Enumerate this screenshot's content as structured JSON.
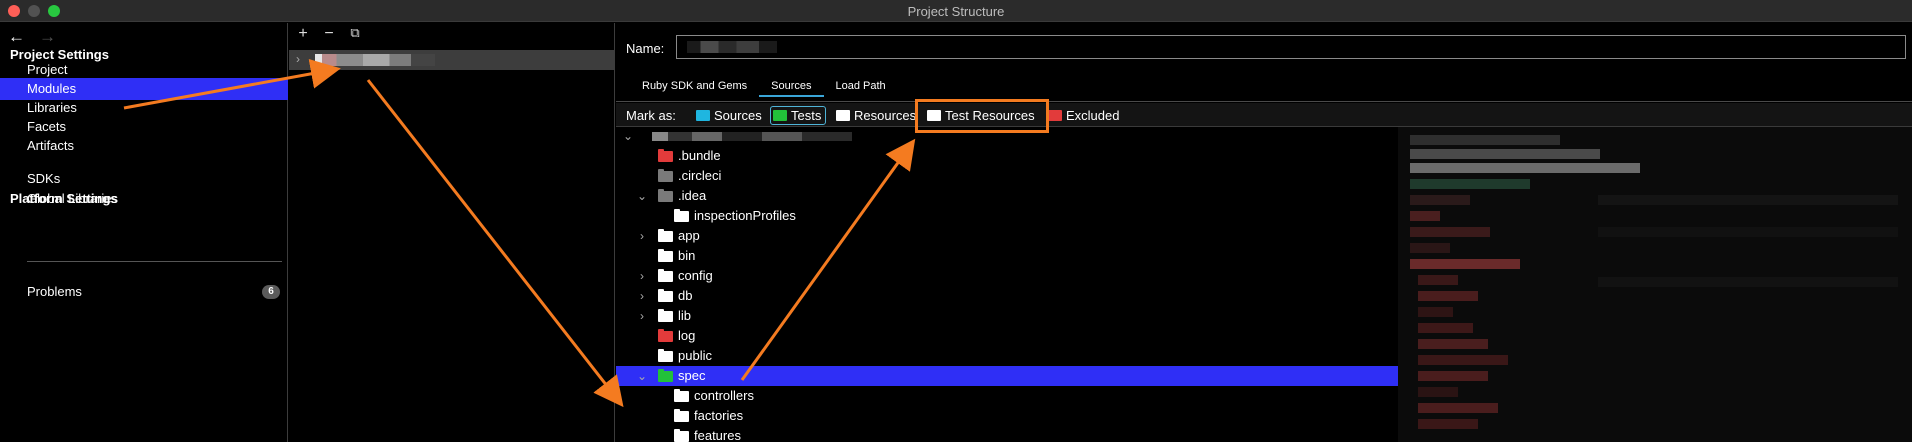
{
  "window": {
    "title": "Project Structure"
  },
  "left_nav": {
    "back_glyph": "←",
    "forward_glyph": "→",
    "project_settings_heading": "Project Settings",
    "project_settings_items": [
      "Project",
      "Modules",
      "Libraries",
      "Facets",
      "Artifacts"
    ],
    "selected_item": "Modules",
    "platform_settings_heading": "Platform Settings",
    "platform_settings_items": [
      "SDKs",
      "Global Libraries"
    ],
    "problems_label": "Problems",
    "problems_count": "6"
  },
  "modules_toolbar": {
    "add": "+",
    "remove": "−",
    "copy": "⧉"
  },
  "module_detail": {
    "name_label": "Name:",
    "tabs": [
      "Ruby SDK and Gems",
      "Sources",
      "Load Path"
    ],
    "active_tab": "Sources",
    "mark_as_label": "Mark as:",
    "mark_as_options": [
      {
        "label": "Sources",
        "folder_color": "#1fb6e0"
      },
      {
        "label": "Tests",
        "folder_color": "#22c13a"
      },
      {
        "label": "Resources",
        "folder_color": "#ffffff"
      },
      {
        "label": "Test Resources",
        "folder_color": "#ffffff"
      },
      {
        "label": "Excluded",
        "folder_color": "#e23b3b"
      }
    ],
    "highlighted_option": "Test Resources"
  },
  "tree": {
    "rows": [
      {
        "label": ".bundle",
        "color": "red",
        "indent": 1,
        "chevron": ""
      },
      {
        "label": ".circleci",
        "color": "grey",
        "indent": 1,
        "chevron": ""
      },
      {
        "label": ".idea",
        "color": "grey",
        "indent": 1,
        "chevron": "⌄"
      },
      {
        "label": "inspectionProfiles",
        "color": "white",
        "indent": 2,
        "chevron": ""
      },
      {
        "label": "app",
        "color": "white",
        "indent": 1,
        "chevron": "›"
      },
      {
        "label": "bin",
        "color": "white",
        "indent": 1,
        "chevron": ""
      },
      {
        "label": "config",
        "color": "white",
        "indent": 1,
        "chevron": "›"
      },
      {
        "label": "db",
        "color": "white",
        "indent": 1,
        "chevron": "›"
      },
      {
        "label": "lib",
        "color": "white",
        "indent": 1,
        "chevron": "›"
      },
      {
        "label": "log",
        "color": "red",
        "indent": 1,
        "chevron": ""
      },
      {
        "label": "public",
        "color": "white",
        "indent": 1,
        "chevron": ""
      },
      {
        "label": "spec",
        "color": "green",
        "indent": 1,
        "chevron": "⌄",
        "selected": true
      },
      {
        "label": "controllers",
        "color": "white",
        "indent": 2,
        "chevron": ""
      },
      {
        "label": "factories",
        "color": "white",
        "indent": 2,
        "chevron": ""
      },
      {
        "label": "features",
        "color": "white",
        "indent": 2,
        "chevron": ""
      }
    ]
  },
  "colors": {
    "selection": "#2f2ff6",
    "annotation": "#f47b20",
    "tab_underline": "#3aa6d8"
  }
}
